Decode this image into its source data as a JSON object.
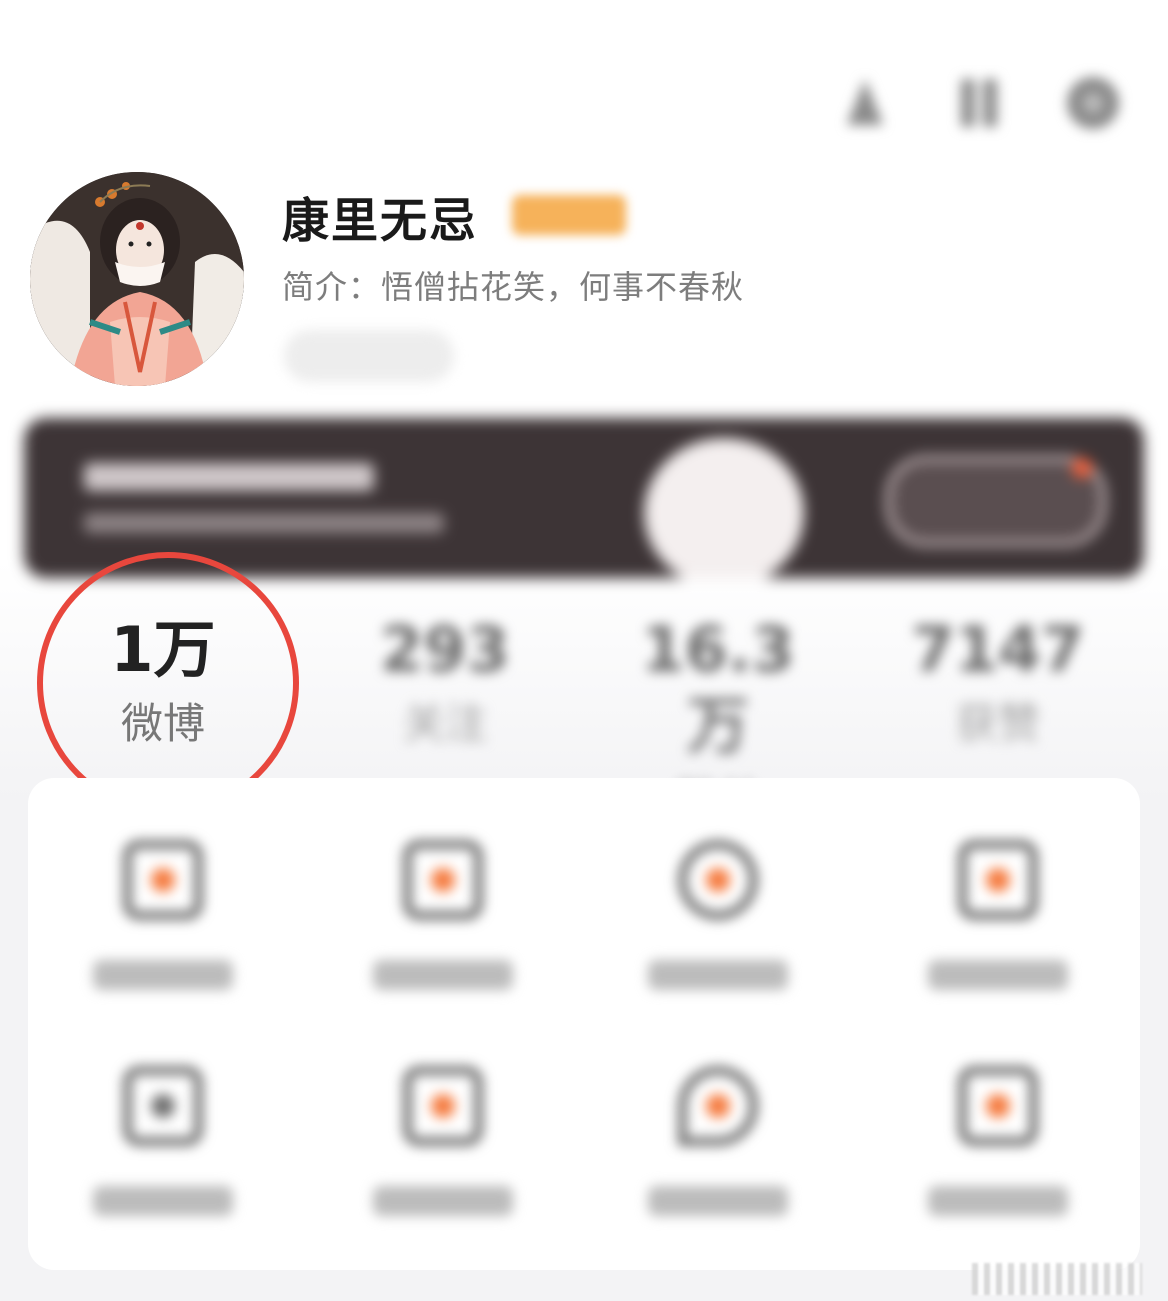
{
  "profile": {
    "name": "康里无忌",
    "bio_label": "简介：",
    "bio_text": "悟僧拈花笑，何事不春秋"
  },
  "stats": [
    {
      "value": "1万",
      "label": "微博"
    },
    {
      "value": "293",
      "label": "关注"
    },
    {
      "value": "16.3万",
      "label": "粉丝"
    },
    {
      "value": "7147",
      "label": "获赞"
    }
  ],
  "icons": {
    "top_right": [
      "profile-icon",
      "qr-code-icon",
      "settings-icon"
    ],
    "menu_grid": [
      "my-photos-icon",
      "like-icon",
      "history-icon",
      "fans-icon",
      "calendar-icon",
      "shopping-bag-icon",
      "location-icon",
      "shirt-icon"
    ]
  },
  "colors": {
    "highlight_circle": "#e8473d",
    "accent_orange": "#f57a3e",
    "vip_badge": "#f6b25a",
    "banner_bg": "#3d3436"
  }
}
